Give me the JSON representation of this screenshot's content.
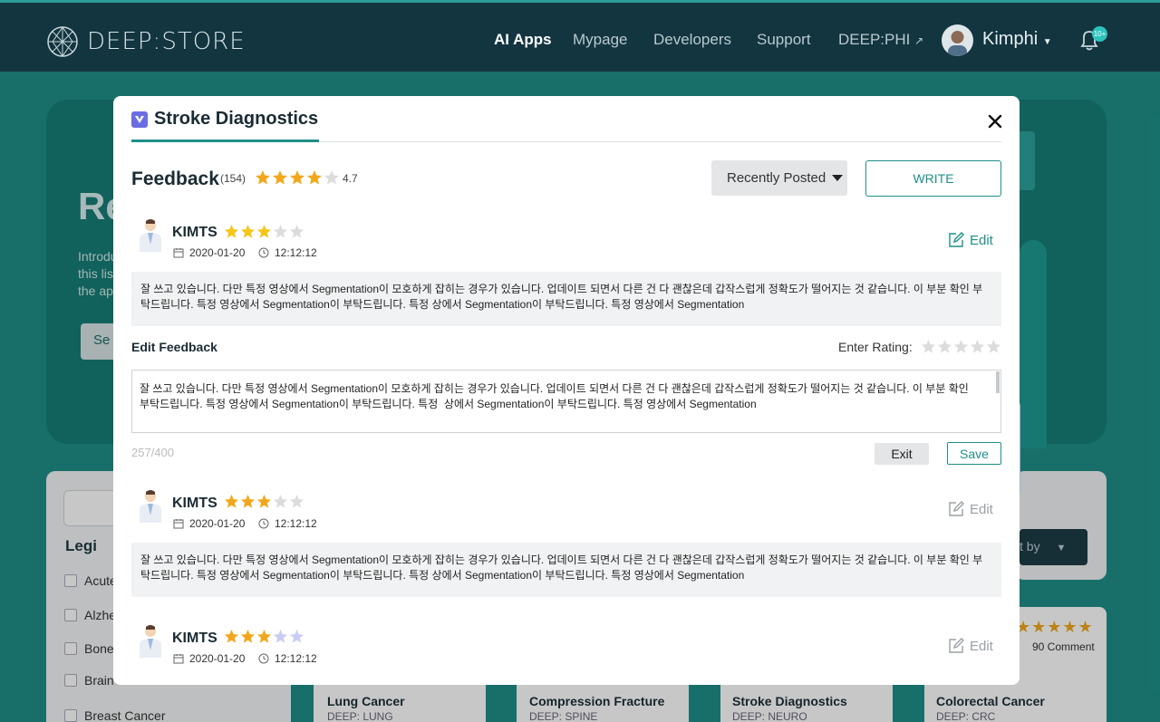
{
  "header": {
    "logo_text": "DEEP:STORE",
    "nav": [
      "AI Apps",
      "Mypage",
      "Developers",
      "Support",
      "DEEP:PHI"
    ],
    "user_name": "Kimphi",
    "notification_badge": "10+"
  },
  "background": {
    "hero_title": "Re",
    "hero_text": "Introduce this list the app",
    "hero_button": "Se",
    "legend_title": "Legi",
    "categories": [
      "Acute",
      "Alzhe",
      "Bone",
      "Brain",
      "Breast Cancer"
    ],
    "sort_label": "t by",
    "cards": [
      {
        "title": "Lung Cancer",
        "sub": "DEEP: LUNG"
      },
      {
        "title": "Compression Fracture",
        "sub": "DEEP: SPINE"
      },
      {
        "title": "Stroke Diagnostics",
        "sub": "DEEP: NEURO"
      },
      {
        "title": "Colorectal Cancer",
        "sub": "DEEP: CRC"
      }
    ],
    "card_comment": "90 Comment"
  },
  "modal": {
    "title": "Stroke Diagnostics",
    "feedback_title": "Feedback",
    "feedback_count": "(154)",
    "rating": 4.7,
    "rating_text": "4.7",
    "sort_label": "Recently Posted",
    "write_label": "WRITE",
    "edit_feedback_label": "Edit Feedback",
    "enter_rating_label": "Enter Rating:",
    "textarea_value": "잘 쓰고 있습니다. 다만 특정 영상에서 Segmentation이 모호하게 잡히는 경우가 있습니다. 업데이트 되면서 다른 건 다 괜찮은데 갑작스럽게 정확도가 떨어지는 것 같습니다. 이 부분 확인 부탁드립니다. 특정 영상에서 Segmentation이 부탁드립니다. 특정  상에서 Segmentation이 부탁드립니다. 특정 영상에서 Segmentation",
    "counter": "257/400",
    "exit_label": "Exit",
    "save_label": "Save",
    "edit_label": "Edit",
    "reviews": [
      {
        "name": "KIMTS",
        "rating": 3,
        "date": "2020-01-20",
        "time": "12:12:12",
        "text": "잘 쓰고 있습니다. 다만 특정 영상에서 Segmentation이 모호하게 잡히는 경우가 있습니다. 업데이트 되면서 다른 건 다 괜찮은데 갑작스럽게 정확도가 떨어지는 것 같습니다. 이 부분 확인 부탁드립니다. 특정 영상에서 Segmentation이 부탁드립니다. 특정  상에서 Segmentation이 부탁드립니다. 특정 영상에서 Segmentation"
      },
      {
        "name": "KIMTS",
        "rating": 3,
        "date": "2020-01-20",
        "time": "12:12:12",
        "text": "잘 쓰고 있습니다. 다만 특정 영상에서 Segmentation이 모호하게 잡히는 경우가 있습니다. 업데이트 되면서 다른 건 다 괜찮은데 갑작스럽게 정확도가 떨어지는 것 같습니다. 이 부분 확인 부탁드립니다. 특정 영상에서 Segmentation이 부탁드립니다. 특정  상에서 Segmentation이 부탁드립니다. 특정 영상에서 Segmentation"
      },
      {
        "name": "KIMTS",
        "rating": 3,
        "date": "2020-01-20",
        "time": "12:12:12"
      }
    ]
  },
  "colors": {
    "accent": "#1f8f88",
    "star": "#f2a71b",
    "star_yellow": "#f5c518",
    "star_empty": "#dcdcdc",
    "star_blue": "#c9cdf5",
    "edit_active": "#1f8f88",
    "edit_inactive": "#9aa0a6"
  }
}
